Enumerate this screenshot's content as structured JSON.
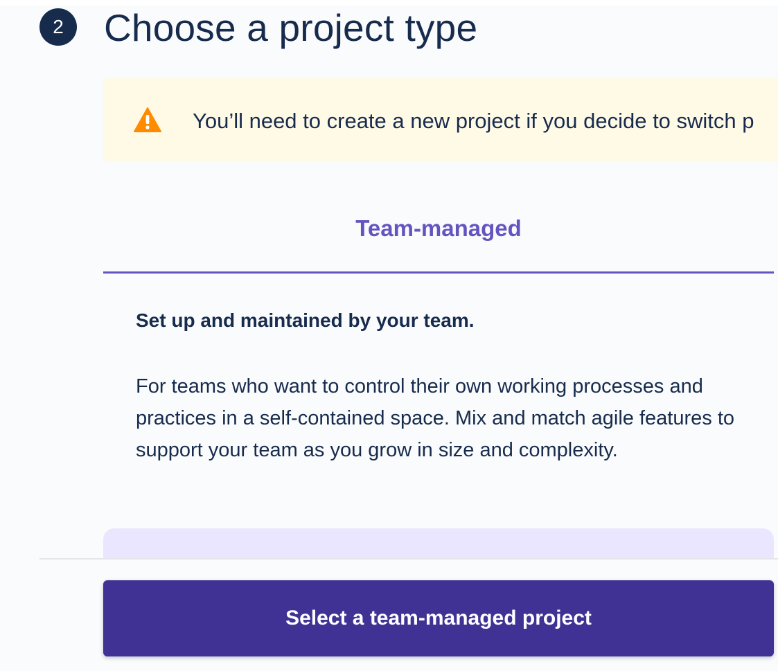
{
  "step": {
    "number": "2",
    "title": "Choose a project type"
  },
  "warning": {
    "icon": "warning-triangle-icon",
    "text": "You’ll need to create a new project if you decide to switch p"
  },
  "tabs": [
    {
      "label": "Team-managed",
      "selected": true
    }
  ],
  "panel": {
    "heading": "Set up and maintained by your team.",
    "description": "For teams who want to control their own working processes and practices in a self-contained space. Mix and match agile features to support your team as you grow in size and complexity."
  },
  "footer": {
    "select_button_label": "Select a team-managed project"
  },
  "colors": {
    "accent": "#6554C0",
    "button": "#403294",
    "text": "#172B4D",
    "warning_bg": "#FFFAE6",
    "warning_icon": "#FF8B00",
    "card_bg": "#EAE6FF"
  }
}
